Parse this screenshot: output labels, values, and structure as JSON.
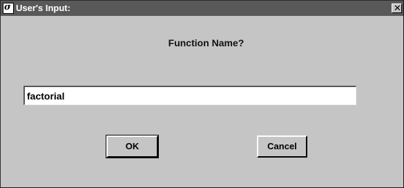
{
  "window": {
    "title": "User's Input:",
    "app_icon": "app-logo-icon",
    "close_glyph": "✕",
    "close_icon": "close-icon"
  },
  "dialog": {
    "prompt": "Function Name?",
    "input_value": "factorial",
    "ok_label": "OK",
    "cancel_label": "Cancel"
  },
  "colors": {
    "titlebar": "#595959",
    "dialog_bg": "#c5c5c5",
    "input_bg": "#ffffff"
  }
}
